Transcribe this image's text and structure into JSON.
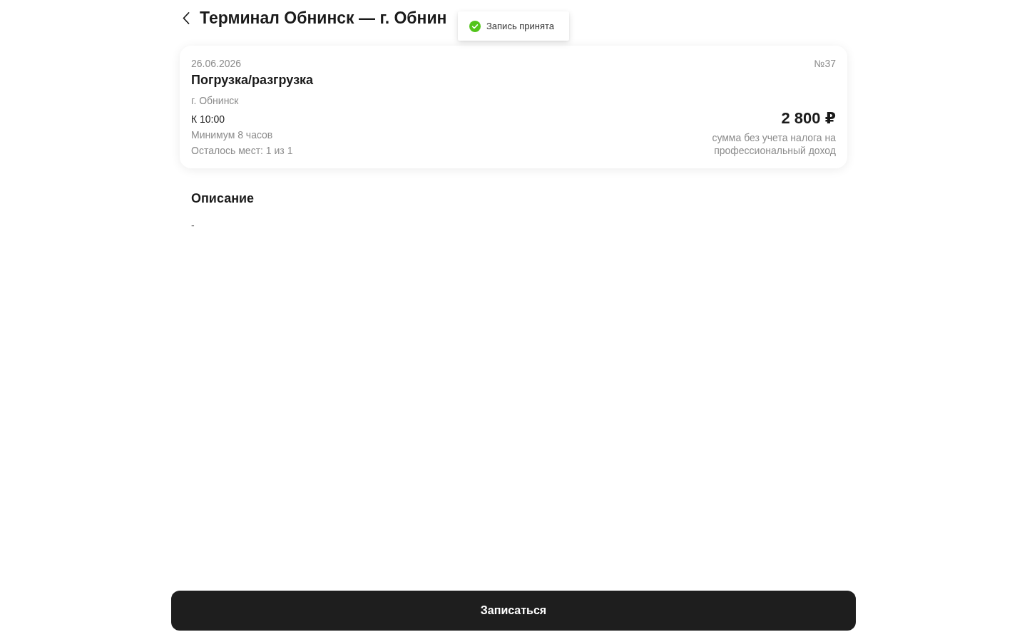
{
  "header": {
    "title": "Терминал Обнинск — г. Обнин"
  },
  "toast": {
    "kind": "success",
    "message": "Запись принята"
  },
  "card": {
    "date": "26.06.2026",
    "number": "№37",
    "title": "Погрузка/разгрузка",
    "city": "г. Обнинск",
    "time": "К 10:00",
    "duration": "Минимум 8 часов",
    "spots": "Осталось мест: 1 из 1",
    "price": "2 800 ₽",
    "price_note": "сумма без учета налога на профессиональный доход"
  },
  "description": {
    "heading": "Описание",
    "text": "-"
  },
  "action": {
    "label": "Записаться"
  }
}
